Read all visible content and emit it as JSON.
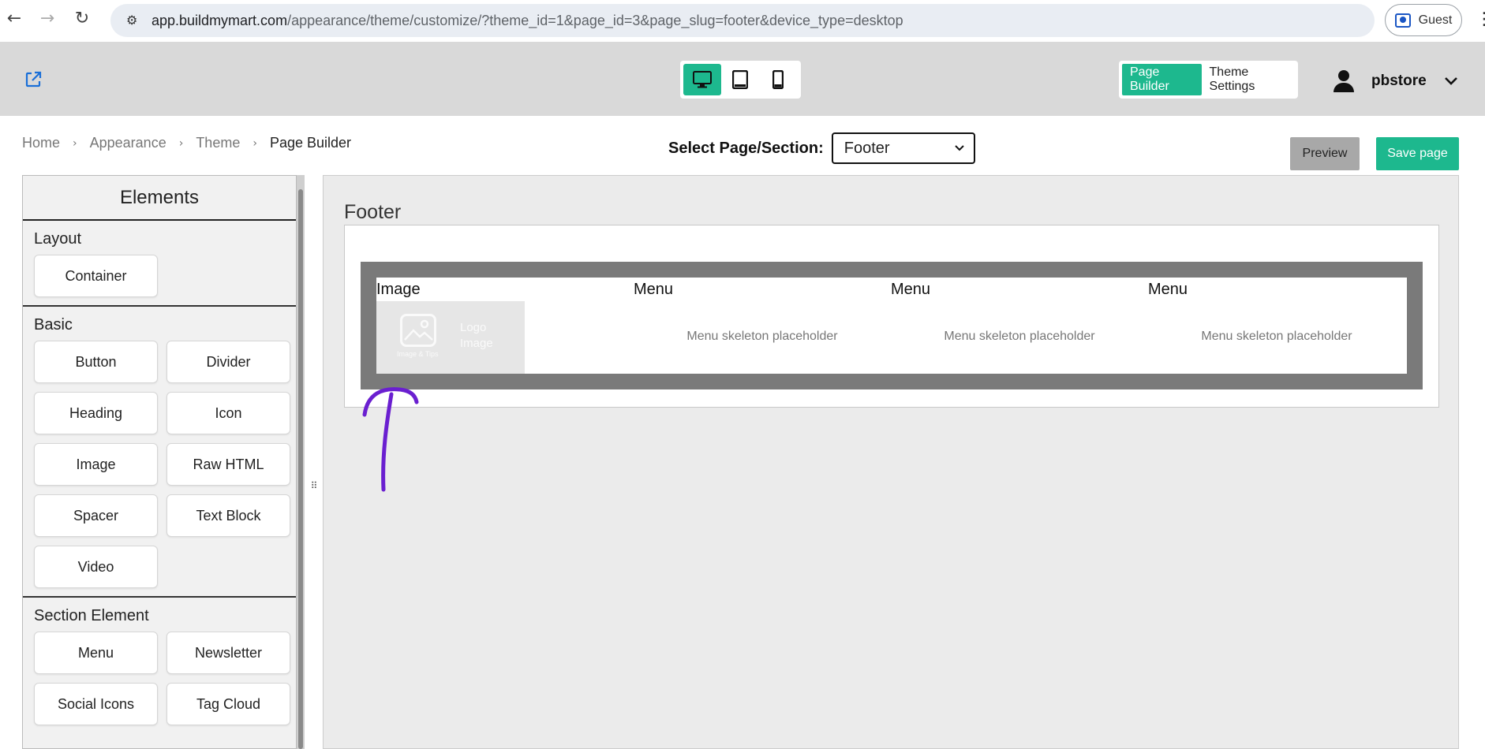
{
  "browser": {
    "url_host": "app.buildmymart.com",
    "url_path": "/appearance/theme/customize/?theme_id=1&page_id=3&page_slug=footer&device_type=desktop",
    "profile_label": "Guest"
  },
  "header": {
    "devices": [
      "desktop-icon",
      "tablet-icon",
      "mobile-icon"
    ],
    "active_device": "desktop",
    "tabs": {
      "page_builder": "Page Builder",
      "theme_settings": "Theme Settings"
    },
    "user": "pbstore",
    "accent": "#1db88e"
  },
  "breadcrumb": {
    "items": [
      "Home",
      "Appearance",
      "Theme",
      "Page Builder"
    ]
  },
  "page_select": {
    "label": "Select Page/Section:",
    "value": "Footer"
  },
  "actions": {
    "preview": "Preview",
    "save": "Save page"
  },
  "elements": {
    "title": "Elements",
    "sections": {
      "layout": {
        "title": "Layout",
        "items": [
          "Container"
        ]
      },
      "basic": {
        "title": "Basic",
        "items": [
          "Button",
          "Divider",
          "Heading",
          "Icon",
          "Image",
          "Raw HTML",
          "Spacer",
          "Text Block",
          "Video"
        ]
      },
      "section_element": {
        "title": "Section Element",
        "items": [
          "Menu",
          "Newsletter",
          "Social Icons",
          "Tag Cloud"
        ]
      }
    }
  },
  "canvas": {
    "title": "Footer",
    "columns": [
      {
        "label": "Image",
        "logo_small": "Image & Tips",
        "logo_text": "Logo Image"
      },
      {
        "label": "Menu",
        "placeholder": "Menu skeleton placeholder"
      },
      {
        "label": "Menu",
        "placeholder": "Menu skeleton placeholder"
      },
      {
        "label": "Menu",
        "placeholder": "Menu skeleton placeholder"
      }
    ]
  }
}
